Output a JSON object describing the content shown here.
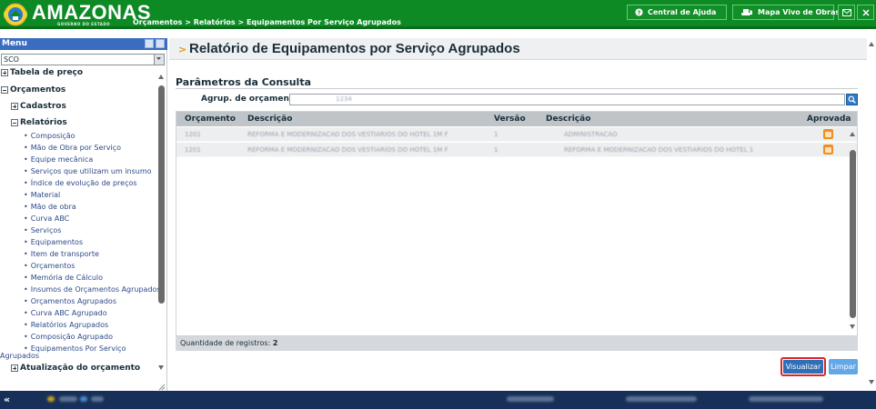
{
  "header": {
    "logo_text": "AMAZONAS",
    "logo_subtitle": "GOVERNO DO ESTADO",
    "breadcrumb": "Orçamentos > Relatórios > Equipamentos Por Serviço Agrupados",
    "help_button": "Central de Ajuda",
    "map_button": "Mapa Vivo de Obras"
  },
  "sidebar": {
    "menu_title": "Menu",
    "system_select": "SCO",
    "tabela_preco": "Tabela de preço",
    "orcamentos": "Orçamentos",
    "cadastros": "Cadastros",
    "relatorios": "Relatórios",
    "report_items": [
      "Composição",
      "Mão de Obra por Serviço",
      "Equipe mecânica",
      "Serviços que utilizam um insumo",
      "Índice de evolução de preços",
      "Material",
      "Mão de obra",
      "Curva ABC",
      "Serviços",
      "Equipamentos",
      "Item de transporte",
      "Orçamentos",
      "Memória de Cálculo",
      "Insumos de Orçamentos Agrupados",
      "Orçamentos Agrupados",
      "Curva ABC Agrupado",
      "Relatórios Agrupados",
      "Composição Agrupado",
      "Equipamentos Por Serviço"
    ],
    "last_item_continuation": "Agrupados",
    "atualizacao": "Atualização do orçamento"
  },
  "main": {
    "title": "Relatório de Equipamentos por Serviço Agrupados",
    "params_title": "Parâmetros da Consulta",
    "group_label": "Agrup. de orçamento*:",
    "group_value": "1234",
    "table": {
      "columns": [
        "Orçamento",
        "Descrição",
        "Versão",
        "Descrição",
        "Aprovada"
      ],
      "rows": [
        {
          "orcamento": "1201",
          "descricao": "REFORMA E MODERNIZACAO DOS VESTIARIOS DO HOTEL 1M F",
          "versao": "1",
          "descricao_versao": "ADMINISTRACAO"
        },
        {
          "orcamento": "1201",
          "descricao": "REFORMA E MODERNIZACAO DOS VESTIARIOS DO HOTEL 1M F",
          "versao": "1",
          "descricao_versao": "REFORMA E MODERNIZACAO DOS VESTIARIOS DO HOTEL 1"
        }
      ]
    },
    "count_label": "Quantidade de registros:",
    "count_value": "2",
    "visualizar_button": "Visualizar",
    "limpar_button": "Limpar"
  },
  "colors": {
    "header_green": "#0d8a24",
    "menu_blue": "#3a6cc0",
    "footer_navy": "#17305a",
    "highlight_red": "#d8262c",
    "approved_orange": "#ee8f22"
  }
}
